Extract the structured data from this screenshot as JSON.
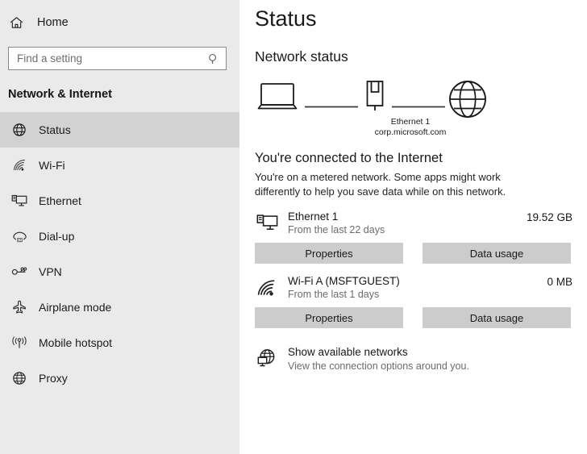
{
  "sidebar": {
    "home": {
      "label": "Home",
      "icon": "home-icon"
    },
    "search": {
      "value": "",
      "placeholder": "Find a setting",
      "icon": "search-icon"
    },
    "section_title": "Network & Internet",
    "items": [
      {
        "label": "Status",
        "icon": "status-globe-icon",
        "selected": true
      },
      {
        "label": "Wi-Fi",
        "icon": "wifi-icon",
        "selected": false
      },
      {
        "label": "Ethernet",
        "icon": "ethernet-icon",
        "selected": false
      },
      {
        "label": "Dial-up",
        "icon": "dialup-icon",
        "selected": false
      },
      {
        "label": "VPN",
        "icon": "vpn-key-icon",
        "selected": false
      },
      {
        "label": "Airplane mode",
        "icon": "airplane-icon",
        "selected": false
      },
      {
        "label": "Mobile hotspot",
        "icon": "mobile-hotspot-icon",
        "selected": false
      },
      {
        "label": "Proxy",
        "icon": "proxy-globe-icon",
        "selected": false
      }
    ]
  },
  "main": {
    "page_title": "Status",
    "section_heading": "Network status",
    "diagram": {
      "device_icon": "laptop-icon",
      "adapter_icon": "ethernet-plug-icon",
      "internet_icon": "globe-icon",
      "adapter_name": "Ethernet 1",
      "domain": "corp.microsoft.com"
    },
    "connection_status": "You're connected to the Internet",
    "metered_note": "You're on a metered network. Some apps might work differently to help you save data while on this network.",
    "adapters": [
      {
        "icon": "ethernet-monitor-icon",
        "name": "Ethernet 1",
        "duration": "From the last 22 days",
        "usage": "19.52 GB",
        "buttons": [
          {
            "label": "Properties",
            "name": "properties-button"
          },
          {
            "label": "Data usage",
            "name": "data-usage-button"
          }
        ]
      },
      {
        "icon": "wifi-signal-icon",
        "name": "Wi-Fi A (MSFTGUEST)",
        "duration": "From the last 1 days",
        "usage": "0 MB",
        "buttons": [
          {
            "label": "Properties",
            "name": "properties-button"
          },
          {
            "label": "Data usage",
            "name": "data-usage-button"
          }
        ]
      }
    ],
    "show_networks": {
      "icon": "show-networks-icon",
      "title": "Show available networks",
      "subtitle": "View the connection options around you."
    }
  },
  "colors": {
    "sidebar_bg": "#eaeaea",
    "selected_bg": "#d2d2d2",
    "button_bg": "#cccccc",
    "content_bg": "#ffffff",
    "text": "#1a1a1a",
    "muted_text": "#6b6b6b"
  }
}
